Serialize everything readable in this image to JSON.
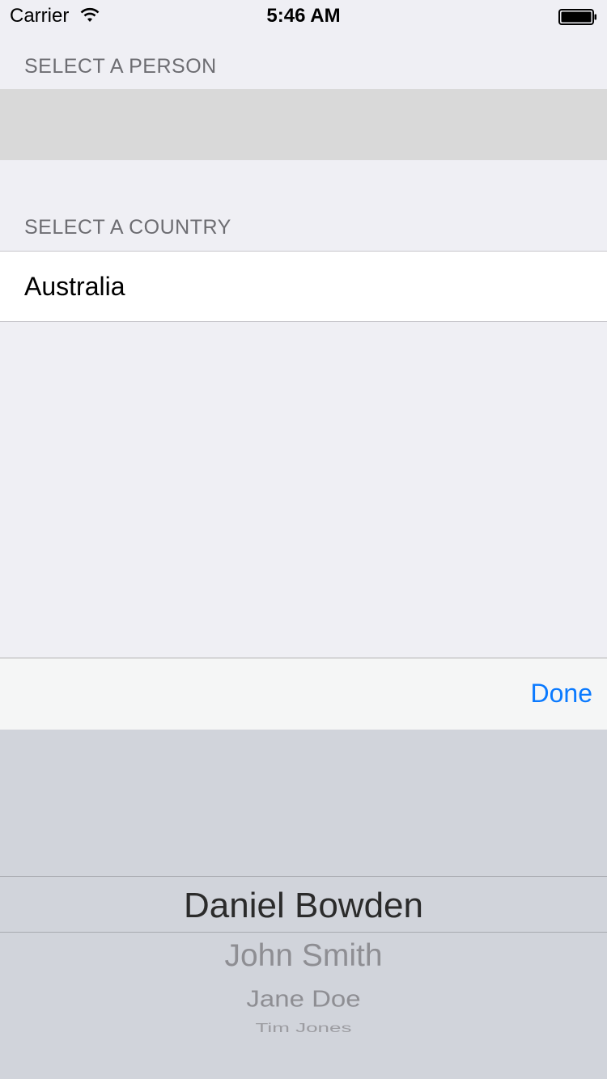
{
  "status_bar": {
    "carrier": "Carrier",
    "time": "5:46 AM",
    "wifi_icon": "wifi-icon",
    "battery_icon": "battery-icon"
  },
  "form": {
    "person_header": "SELECT A PERSON",
    "person_value": "",
    "country_header": "SELECT A COUNTRY",
    "country_value": "Australia"
  },
  "toolbar": {
    "done_label": "Done",
    "accent_color": "#0a7aff"
  },
  "picker": {
    "options": [
      "Daniel Bowden",
      "John Smith",
      "Jane Doe",
      "Tim Jones"
    ],
    "selected": "Daniel Bowden"
  }
}
